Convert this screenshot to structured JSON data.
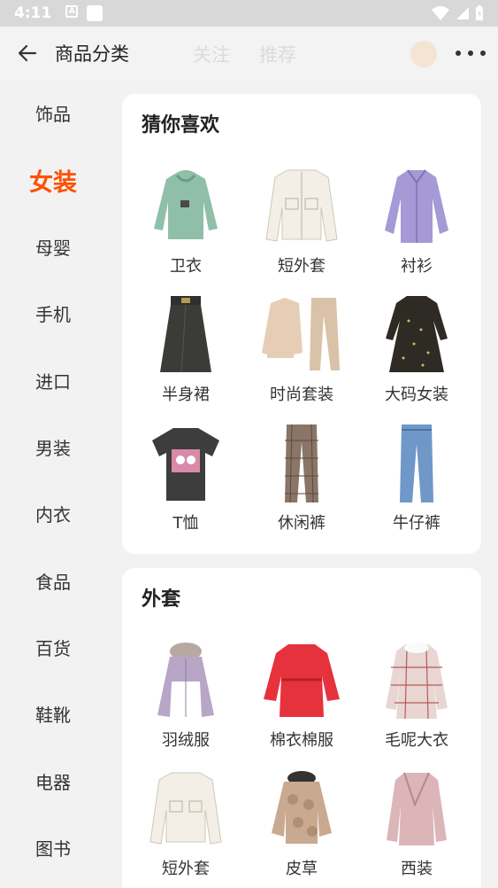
{
  "status_bar": {
    "time": "4:11",
    "colors": {
      "bg": "#d8d8d8"
    }
  },
  "top_bar": {
    "title": "商品分类",
    "back_icon": "arrow-left-icon",
    "more_icon": "more-dots-icon",
    "ghost_tabs": [
      "关注",
      "推荐"
    ]
  },
  "theme": {
    "accent": "#ff5000"
  },
  "sidebar": {
    "items": [
      {
        "label": "饰品",
        "active": false
      },
      {
        "label": "女装",
        "active": true
      },
      {
        "label": "母婴",
        "active": false
      },
      {
        "label": "手机",
        "active": false
      },
      {
        "label": "进口",
        "active": false
      },
      {
        "label": "男装",
        "active": false
      },
      {
        "label": "内衣",
        "active": false
      },
      {
        "label": "食品",
        "active": false
      },
      {
        "label": "百货",
        "active": false
      },
      {
        "label": "鞋靴",
        "active": false
      },
      {
        "label": "电器",
        "active": false
      },
      {
        "label": "图书",
        "active": false
      }
    ]
  },
  "sections": [
    {
      "title": "猜你喜欢",
      "items": [
        {
          "label": "卫衣",
          "icon": "hoodie-icon"
        },
        {
          "label": "短外套",
          "icon": "short-jacket-icon"
        },
        {
          "label": "衬衫",
          "icon": "shirt-icon"
        },
        {
          "label": "半身裙",
          "icon": "skirt-icon"
        },
        {
          "label": "时尚套装",
          "icon": "suit-set-icon"
        },
        {
          "label": "大码女装",
          "icon": "dress-icon"
        },
        {
          "label": "T恤",
          "icon": "tshirt-icon"
        },
        {
          "label": "休闲裤",
          "icon": "pants-icon"
        },
        {
          "label": "牛仔裤",
          "icon": "jeans-icon"
        }
      ]
    },
    {
      "title": "外套",
      "items": [
        {
          "label": "羽绒服",
          "icon": "down-jacket-icon"
        },
        {
          "label": "棉衣棉服",
          "icon": "padded-coat-icon"
        },
        {
          "label": "毛呢大衣",
          "icon": "wool-coat-icon"
        },
        {
          "label": "短外套",
          "icon": "short-jacket-icon"
        },
        {
          "label": "皮草",
          "icon": "fur-coat-icon"
        },
        {
          "label": "西装",
          "icon": "blazer-icon"
        }
      ]
    }
  ]
}
